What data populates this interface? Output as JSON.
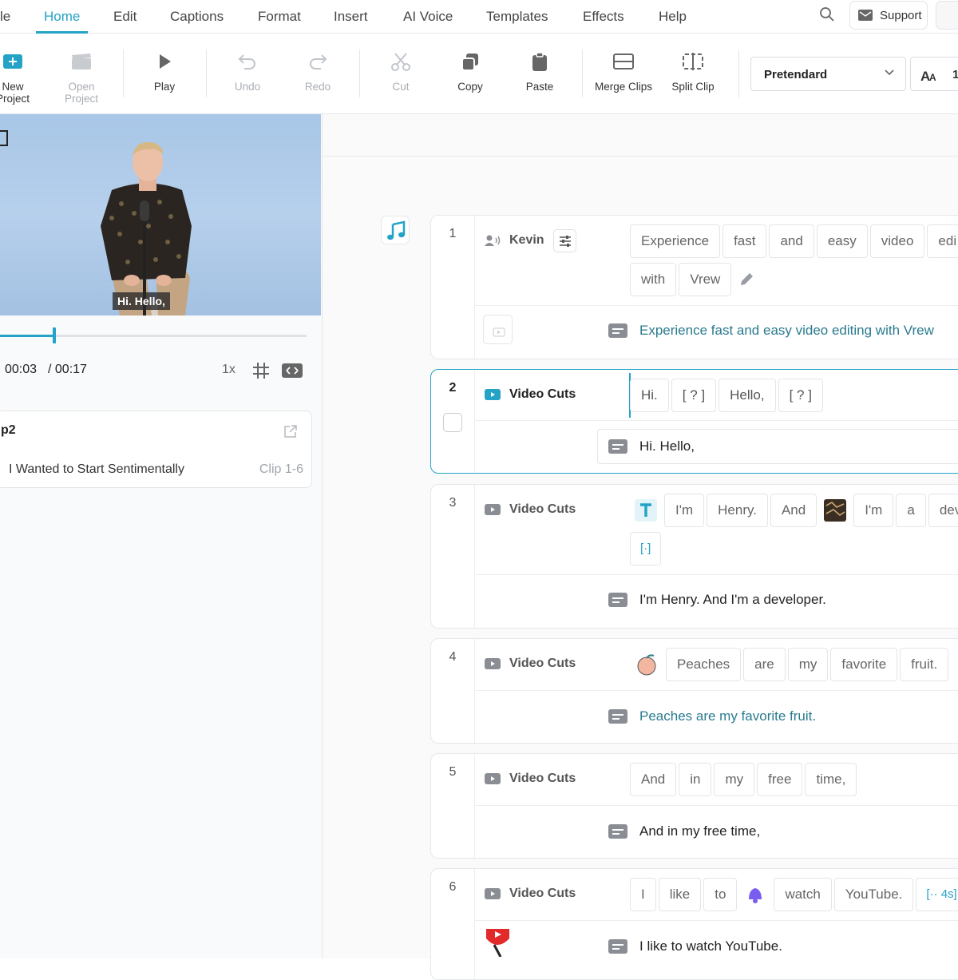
{
  "menu": {
    "items": [
      "le",
      "Home",
      "Edit",
      "Captions",
      "Format",
      "Insert",
      "AI Voice",
      "Templates",
      "Effects",
      "Help"
    ],
    "active": "Home",
    "support_label": "Support"
  },
  "toolbar": {
    "new_project": "New\nProject",
    "open_project": "Open\nProject",
    "play": "Play",
    "undo": "Undo",
    "redo": "Redo",
    "cut": "Cut",
    "copy": "Copy",
    "paste": "Paste",
    "merge_clips": "Merge Clips",
    "split_clip": "Split Clip",
    "font": "Pretendard",
    "font_size": "1"
  },
  "colors": {
    "accent": "#24a3c6",
    "caption_link": "#2a7b8f"
  },
  "player": {
    "caption_overlay": "Hi. Hello,",
    "time_current": "00:03",
    "time_total": "/ 00:17",
    "progress": 0.176,
    "speed": "1x"
  },
  "clip_card": {
    "title": "p2",
    "name": "I Wanted to Start Sentimentally",
    "range": "Clip 1-6"
  },
  "clips": [
    {
      "num": "1",
      "speaker": "Kevin",
      "speaker_icon": "voice-speaker-icon",
      "words": [
        "Experience",
        "fast",
        "and",
        "easy",
        "video",
        "edi",
        "with",
        "Vrew"
      ],
      "caption": "Experience fast and easy video editing with Vrew"
    },
    {
      "num": "2",
      "speaker": "Video Cuts",
      "speaker_icon": "video-camera-icon",
      "words": [
        "Hi.",
        "[ ? ]",
        "Hello,",
        "[ ? ]"
      ],
      "caption": "Hi. Hello,"
    },
    {
      "num": "3",
      "speaker": "Video Cuts",
      "speaker_icon": "video-camera-icon",
      "words": [
        "I'm",
        "Henry.",
        "And",
        "I'm",
        "a",
        "dev",
        "[·]"
      ],
      "caption": "I'm Henry. And I'm a developer."
    },
    {
      "num": "4",
      "speaker": "Video Cuts",
      "speaker_icon": "video-camera-icon",
      "words": [
        "Peaches",
        "are",
        "my",
        "favorite",
        "fruit."
      ],
      "caption": "Peaches are my favorite fruit."
    },
    {
      "num": "5",
      "speaker": "Video Cuts",
      "speaker_icon": "video-camera-icon",
      "words": [
        "And",
        "in",
        "my",
        "free",
        "time,"
      ],
      "caption": "And in my free time,"
    },
    {
      "num": "6",
      "speaker": "Video Cuts",
      "speaker_icon": "video-camera-icon",
      "words": [
        "I",
        "like",
        "to",
        "watch",
        "YouTube.",
        "[·· 4s]"
      ],
      "caption": "I like to watch YouTube."
    }
  ]
}
